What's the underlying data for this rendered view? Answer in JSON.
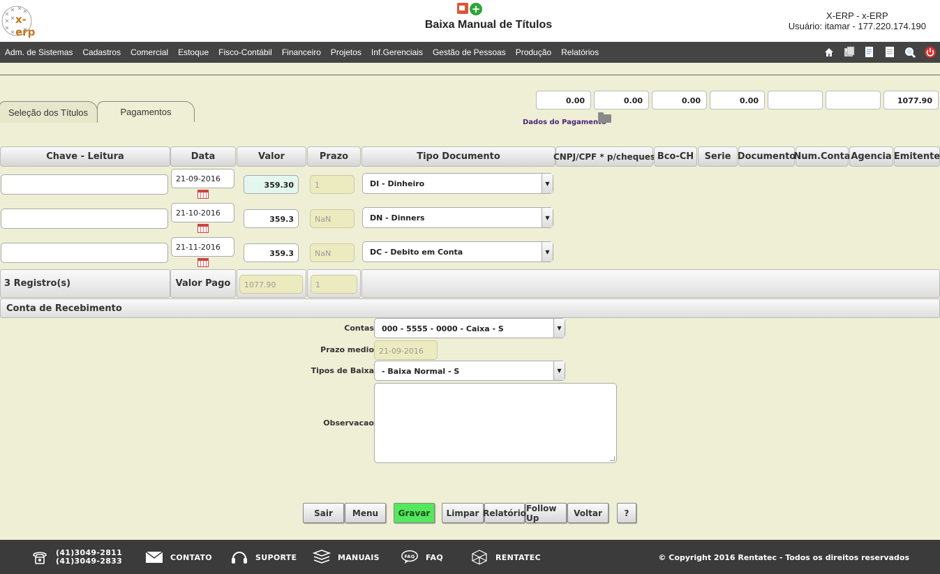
{
  "header": {
    "logo_text": "x-erp",
    "title": "Baixa Manual de Títulos",
    "user_line1": "X-ERP - x-ERP",
    "user_line2": "Usuário: itamar - 177.220.174.190"
  },
  "menu": [
    "Adm. de Sistemas",
    "Cadastros",
    "Comercial",
    "Estoque",
    "Fisco-Contábil",
    "Financeiro",
    "Projetos",
    "Inf.Gerenciais",
    "Gestão de Pessoas",
    "Produção",
    "Relatórios"
  ],
  "toolbar_icons": [
    "home-icon",
    "save-icon",
    "document-edit-icon",
    "report-icon",
    "search-icon",
    "power-icon"
  ],
  "tabs": {
    "selection": "Seleção dos Títulos",
    "payments": "Pagamentos"
  },
  "totals": [
    "0.00",
    "0.00",
    "0.00",
    "0.00",
    "",
    "",
    "1077.90"
  ],
  "dados_label": "Dados do Pagamento",
  "columns": [
    "Chave - Leitura",
    "Data",
    "Valor",
    "Prazo",
    "Tipo Documento",
    "CNPJ/CPF * p/cheques",
    "Bco-CH",
    "Serie",
    "Documento",
    "Num.Conta",
    "Agencia",
    "Emitente"
  ],
  "rows": [
    {
      "chave": "",
      "date": "21-09-2016",
      "valor": "359.30",
      "prazo": "1",
      "tipo": "DI - Dinheiro"
    },
    {
      "chave": "",
      "date": "21-10-2016",
      "valor": "359.3",
      "prazo": "NaN",
      "tipo": "DN - Dinners"
    },
    {
      "chave": "",
      "date": "21-11-2016",
      "valor": "359.3",
      "prazo": "NaN",
      "tipo": "DC - Debito em Conta"
    }
  ],
  "summary": {
    "registros": "3 Registro(s)",
    "valor_pago_label": "Valor Pago",
    "valor_pago": "1077.90",
    "prazo": "1"
  },
  "conta": {
    "section_title": "Conta de Recebimento",
    "contas_label": "Contas",
    "contas_value": "000 - 5555 - 0000 - Caixa - S",
    "prazo_label": "Prazo medio",
    "prazo_value": "21-09-2016",
    "tipos_label": "Tipos de Baixa",
    "tipos_value": "- Baixa Normal - S",
    "obs_label": "Observacao",
    "obs_value": ""
  },
  "buttons": {
    "sair": "Sair",
    "menu": "Menu",
    "gravar": "Gravar",
    "limpar": "Limpar",
    "relatorio": "Relatório",
    "followup": "Follow Up",
    "voltar": "Voltar",
    "help": "?"
  },
  "footer": {
    "phone1": "(41)3049-2811",
    "phone2": "(41)3049-2833",
    "contato": "CONTATO",
    "suporte": "SUPORTE",
    "manuais": "MANUAIS",
    "faq": "FAQ",
    "rentatec": "RENTATEC",
    "copyright": "© Copyright 2016 Rentatec - Todos os direitos reservados"
  }
}
